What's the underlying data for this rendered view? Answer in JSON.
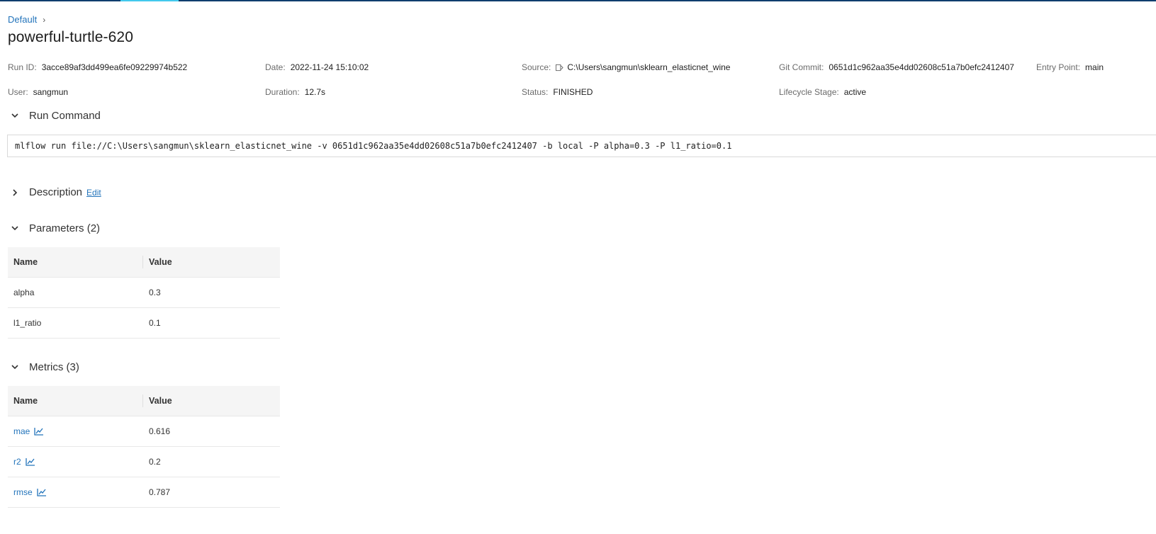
{
  "breadcrumb": {
    "experiment": "Default",
    "separator": "›"
  },
  "page_title": "powerful-turtle-620",
  "metadata": {
    "run_id": {
      "label": "Run ID:",
      "value": "3acce89af3dd499ea6fe09229974b522"
    },
    "date": {
      "label": "Date:",
      "value": "2022-11-24 15:10:02"
    },
    "source": {
      "label": "Source:",
      "value": "C:\\Users\\sangmun\\sklearn_elasticnet_wine"
    },
    "git_commit": {
      "label": "Git Commit:",
      "value": "0651d1c962aa35e4dd02608c51a7b0efc2412407"
    },
    "entry_point": {
      "label": "Entry Point:",
      "value": "main"
    },
    "user": {
      "label": "User:",
      "value": "sangmun"
    },
    "duration": {
      "label": "Duration:",
      "value": "12.7s"
    },
    "status": {
      "label": "Status:",
      "value": "FINISHED"
    },
    "lifecycle_stage": {
      "label": "Lifecycle Stage:",
      "value": "active"
    }
  },
  "sections": {
    "run_command": {
      "title": "Run Command",
      "expanded": true,
      "command": "mlflow run file://C:\\Users\\sangmun\\sklearn_elasticnet_wine -v 0651d1c962aa35e4dd02608c51a7b0efc2412407 -b local -P alpha=0.3 -P l1_ratio=0.1"
    },
    "description": {
      "title": "Description",
      "edit_label": "Edit",
      "expanded": false
    },
    "parameters": {
      "title": "Parameters (2)",
      "expanded": true,
      "headers": {
        "name": "Name",
        "value": "Value"
      },
      "rows": [
        {
          "name": "alpha",
          "value": "0.3"
        },
        {
          "name": "l1_ratio",
          "value": "0.1"
        }
      ]
    },
    "metrics": {
      "title": "Metrics (3)",
      "expanded": true,
      "headers": {
        "name": "Name",
        "value": "Value"
      },
      "rows": [
        {
          "name": "mae",
          "value": "0.616",
          "icon": "line-chart-icon"
        },
        {
          "name": "r2",
          "value": "0.2",
          "icon": "line-chart-icon"
        },
        {
          "name": "rmse",
          "value": "0.787",
          "icon": "line-chart-icon"
        }
      ]
    }
  },
  "colors": {
    "link": "#2374bb",
    "topbar": "#0f3d6e",
    "topbar_accent": "#43c9ed"
  }
}
